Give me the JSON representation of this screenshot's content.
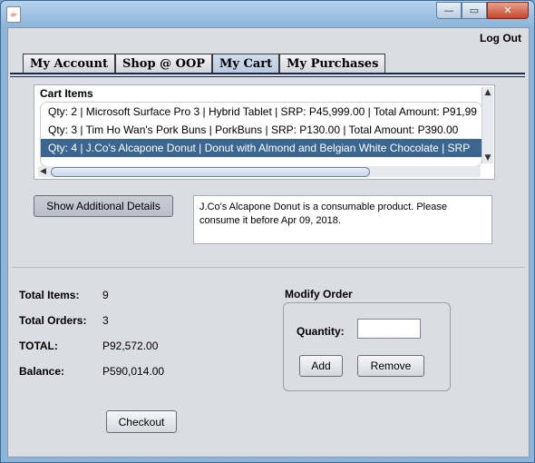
{
  "window": {
    "title": ""
  },
  "titlebar": {
    "min_glyph": "—",
    "max_glyph": "▭",
    "close_glyph": "✕"
  },
  "header": {
    "logout_label": "Log Out"
  },
  "tabs": [
    {
      "label": "My Account",
      "active": false
    },
    {
      "label": "Shop @ OOP",
      "active": false
    },
    {
      "label": "My Cart",
      "active": true
    },
    {
      "label": "My Purchases",
      "active": false
    }
  ],
  "cart": {
    "title": "Cart Items",
    "items": [
      "Qty: 2 | Microsoft Surface Pro 3 | Hybrid Tablet | SRP: P45,999.00 | Total Amount: P91,99",
      "Qty: 3 | Tim Ho Wan's Pork Buns | PorkBuns | SRP: P130.00 | Total Amount: P390.00",
      "Qty: 4 | J.Co's Alcapone Donut | Donut with Almond and Belgian White Chocolate | SRP"
    ],
    "selected_index": 2
  },
  "details": {
    "button_label": "Show Additional Details",
    "text": "J.Co's Alcapone Donut is a consumable product. Please consume it before Apr 09, 2018."
  },
  "summary": {
    "total_items_label": "Total Items:",
    "total_items": "9",
    "total_orders_label": "Total Orders:",
    "total_orders": "3",
    "total_label": "TOTAL:",
    "total": "P92,572.00",
    "balance_label": "Balance:",
    "balance": "P590,014.00"
  },
  "modify": {
    "title": "Modify Order",
    "quantity_label": "Quantity:",
    "quantity_value": "",
    "add_label": "Add",
    "remove_label": "Remove"
  },
  "checkout": {
    "label": "Checkout"
  },
  "colors": {
    "selection": "#3a6690",
    "panel": "#dcdde3",
    "titlebar": "#8db4d9",
    "close": "#c4462c"
  }
}
